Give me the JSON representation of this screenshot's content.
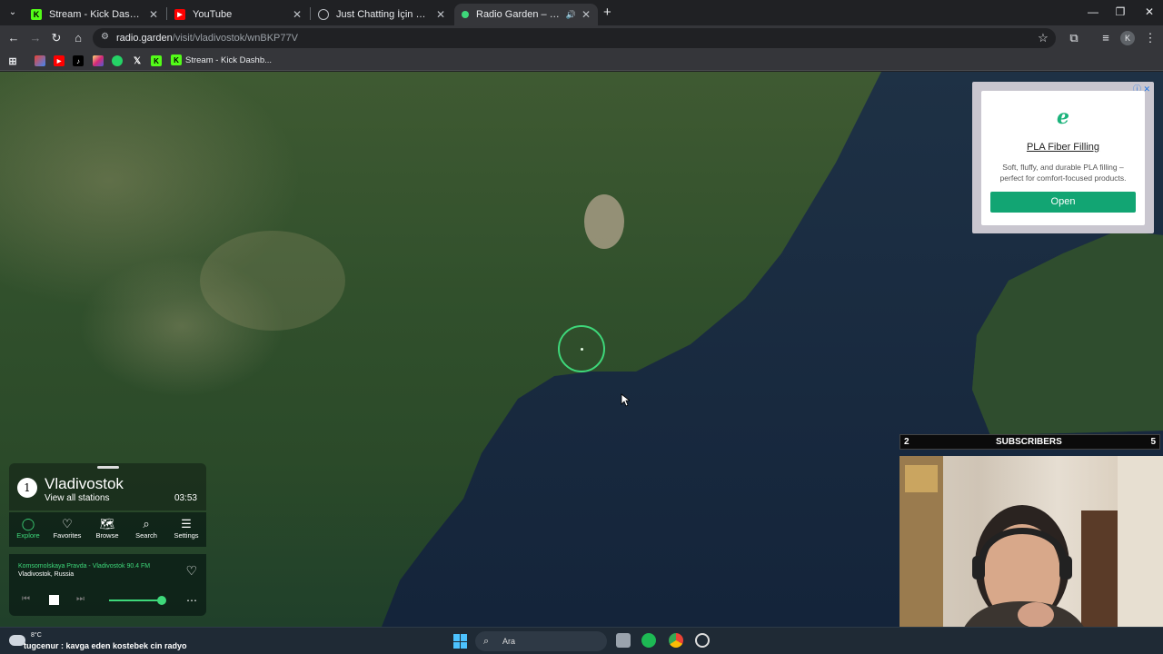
{
  "browser": {
    "tabs": [
      {
        "title": "Stream - Kick Dashboard",
        "favicon": "kick-icon",
        "active": false
      },
      {
        "title": "YouTube",
        "favicon": "youtube-icon",
        "active": false
      },
      {
        "title": "Just Chatting İçin Siteler",
        "favicon": "page-icon",
        "active": false
      },
      {
        "title": "Radio Garden – Vladivostok",
        "favicon": "radio-garden-icon",
        "active": true
      }
    ],
    "new_tab": "+",
    "url_host": "radio.garden",
    "url_path": "/visit/vladivostok/wnBKP77V",
    "profile_initial": "K",
    "bookmarks": {
      "kick_label": "Stream - Kick Dashb..."
    }
  },
  "ad": {
    "title": "PLA Fiber Filling",
    "description": "Soft, fluffy, and durable PLA filling – perfect for comfort-focused products.",
    "cta": "Open",
    "accent": "#12a573"
  },
  "stream_overlay": {
    "left_count": "2",
    "label": "SUBSCRIBERS",
    "right_count": "5"
  },
  "radio_garden": {
    "badge": "1",
    "city": "Vladivostok",
    "view_all": "View all stations",
    "time": "03:53",
    "nav": [
      {
        "label": "Explore",
        "icon": "explore-icon",
        "active": true
      },
      {
        "label": "Favorites",
        "icon": "heart-icon",
        "active": false
      },
      {
        "label": "Browse",
        "icon": "map-icon",
        "active": false
      },
      {
        "label": "Search",
        "icon": "search-icon",
        "active": false
      },
      {
        "label": "Settings",
        "icon": "menu-icon",
        "active": false
      }
    ],
    "station": "Komsomolskaya Pravda - Vladivostok 90.4 FM",
    "location": "Vladivostok, Russia",
    "accent": "#3ed87a"
  },
  "taskbar": {
    "temperature": "8°C",
    "ticker": "tugcenur : kavga eden kostebek cin radyo",
    "search_placeholder": "Ara"
  }
}
